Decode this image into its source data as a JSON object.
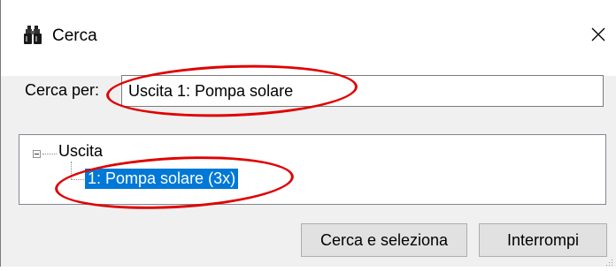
{
  "window": {
    "title": "Cerca",
    "title_icon": "binoculars-icon",
    "close_icon": "close-icon"
  },
  "search": {
    "label": "Cerca per:",
    "value": "Uscita 1: Pompa solare"
  },
  "tree": {
    "root_label": "Uscita",
    "expander_state": "expanded",
    "child_label": "1: Pompa solare  (3x)",
    "selected_color": "#0078d7"
  },
  "buttons": {
    "search_select": "Cerca e seleziona",
    "stop": "Interrompi"
  },
  "annotation_color": "#e00000"
}
